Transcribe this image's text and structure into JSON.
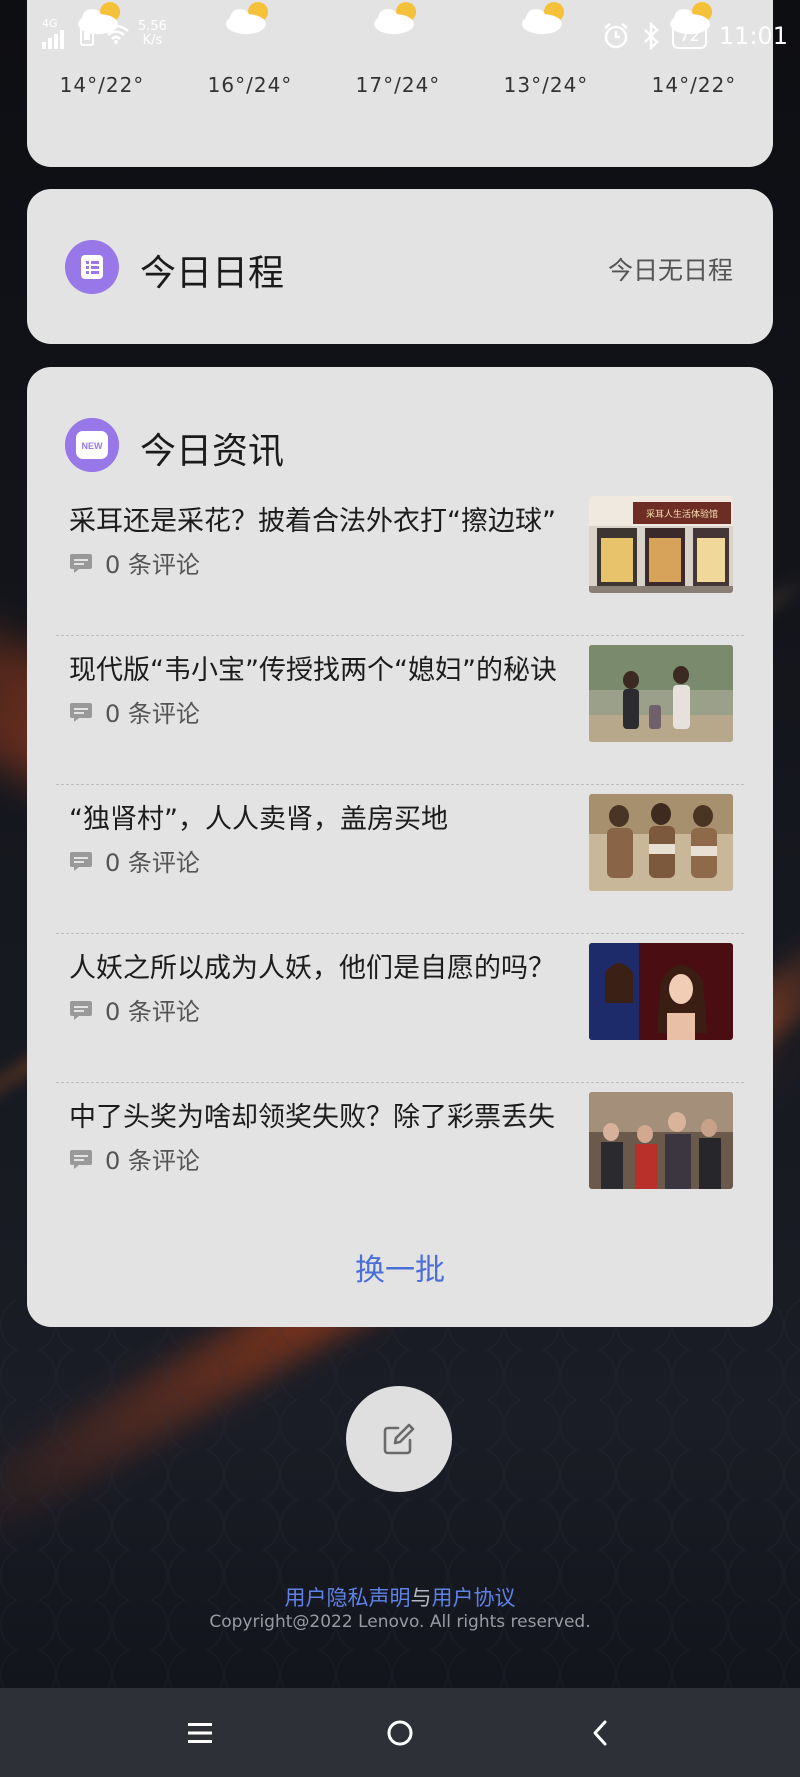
{
  "status_bar": {
    "network": "4G",
    "speed_value": "5.56",
    "speed_unit": "K/s",
    "battery": "72",
    "time": "11:01"
  },
  "weather": {
    "days": [
      {
        "temp": "14°/22°",
        "icon": "partly-cloudy-icon"
      },
      {
        "temp": "16°/24°",
        "icon": "partly-cloudy-icon"
      },
      {
        "temp": "17°/24°",
        "icon": "partly-cloudy-icon"
      },
      {
        "temp": "13°/24°",
        "icon": "partly-cloudy-icon"
      },
      {
        "temp": "14°/22°",
        "icon": "partly-cloudy-icon"
      }
    ]
  },
  "schedule": {
    "title": "今日日程",
    "status": "今日无日程"
  },
  "news": {
    "title": "今日资讯",
    "badge": "NEW",
    "items": [
      {
        "title": "采耳还是采花？披着合法外衣打“擦边球”",
        "comments": "0 条评论"
      },
      {
        "title": "现代版“韦小宝”传授找两个“媳妇”的秘诀",
        "comments": "0 条评论"
      },
      {
        "title": "“独肾村”，人人卖肾，盖房买地",
        "comments": "0 条评论"
      },
      {
        "title": "人妖之所以成为人妖，他们是自愿的吗？",
        "comments": "0 条评论"
      },
      {
        "title": "中了头奖为啥却领奖失败？除了彩票丢失",
        "comments": "0 条评论"
      }
    ],
    "thumb_sign": "采耳人生活体验馆",
    "refresh_label": "换一批"
  },
  "footer": {
    "privacy": "用户隐私声明",
    "and": "与",
    "agreement": "用户协议",
    "copyright": "Copyright@2022 Lenovo. All rights reserved."
  },
  "colors": {
    "accent_purple": "#9878e8",
    "link_blue": "#5f82e6",
    "card_bg": "#e4e3e3"
  }
}
